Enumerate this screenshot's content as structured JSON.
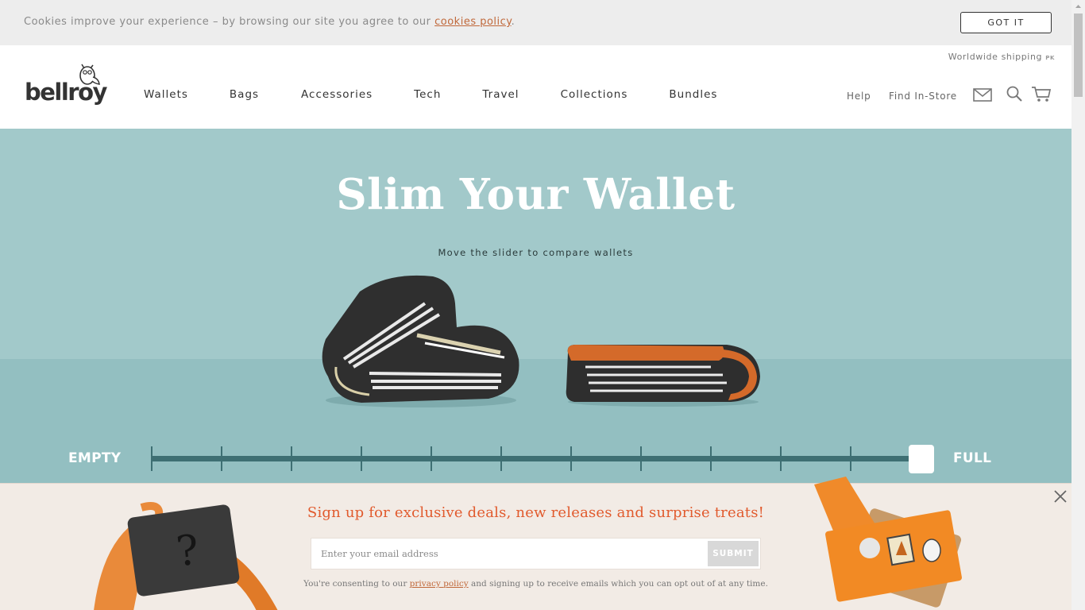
{
  "cookie": {
    "text": "Cookies improve your experience – by browsing our site you agree to our ",
    "link": "cookies policy",
    "suffix": ".",
    "button": "GOT IT"
  },
  "header": {
    "logo": "bellroy",
    "shipping": "Worldwide shipping",
    "shipping_code": "PK",
    "nav": [
      "Wallets",
      "Bags",
      "Accessories",
      "Tech",
      "Travel",
      "Collections",
      "Bundles"
    ],
    "help": "Help",
    "find_store": "Find In-Store",
    "icons": [
      "mail-icon",
      "search-icon",
      "cart-icon"
    ]
  },
  "hero": {
    "title": "Slim Your Wallet",
    "subtitle": "Move the slider to compare wallets",
    "slider": {
      "min_label": "EMPTY",
      "max_label": "FULL",
      "steps": 11,
      "value_fraction": 1.0
    }
  },
  "signup": {
    "title": "Sign up for exclusive deals, new releases and surprise treats!",
    "placeholder": "Enter your email address",
    "submit": "SUBMIT",
    "consent_prefix": "You're consenting to our ",
    "consent_link": "privacy policy",
    "consent_suffix": " and signing up to receive emails which you can opt out of at any time."
  },
  "colors": {
    "hero_bg": "#a2c9ca",
    "slider": "#3e6f73",
    "accent": "#e15a2d",
    "link": "#c0683a",
    "signup_bg": "#f2ebe5"
  }
}
